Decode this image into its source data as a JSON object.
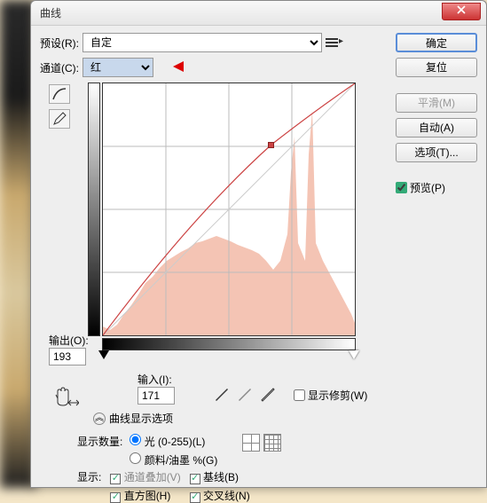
{
  "window": {
    "title": "曲线"
  },
  "preset": {
    "label": "预设(R):",
    "selected": "自定"
  },
  "channel": {
    "label": "通道(C):",
    "selected": "红"
  },
  "buttons": {
    "ok": "确定",
    "cancel": "复位",
    "smooth": "平滑(M)",
    "auto": "自动(A)",
    "options": "选项(T)..."
  },
  "preview": {
    "label": "预览(P)",
    "checked": true
  },
  "output": {
    "label": "输出(O):",
    "value": "193"
  },
  "input": {
    "label": "输入(I):",
    "value": "171"
  },
  "show_clip": {
    "label": "显示修剪(W)",
    "checked": false
  },
  "options_header": "曲线显示选项",
  "show_amount": {
    "label": "显示数量:",
    "radio_light": "光 (0-255)(L)",
    "radio_pigment": "颜料/油墨 %(G)",
    "selected": "light"
  },
  "show": {
    "label": "显示:",
    "overlay": {
      "label": "通道叠加(V)",
      "checked": true
    },
    "histogram": {
      "label": "直方图(H)",
      "checked": true
    },
    "baseline": {
      "label": "基线(B)",
      "checked": true
    },
    "intersection": {
      "label": "交叉线(N)",
      "checked": true
    }
  },
  "chart_data": {
    "type": "curve",
    "x_range": [
      0,
      255
    ],
    "y_range": [
      0,
      255
    ],
    "control_points": [
      {
        "x": 0,
        "y": 0
      },
      {
        "x": 171,
        "y": 193
      },
      {
        "x": 255,
        "y": 255
      }
    ],
    "current_point": {
      "input": 171,
      "output": 193
    }
  }
}
